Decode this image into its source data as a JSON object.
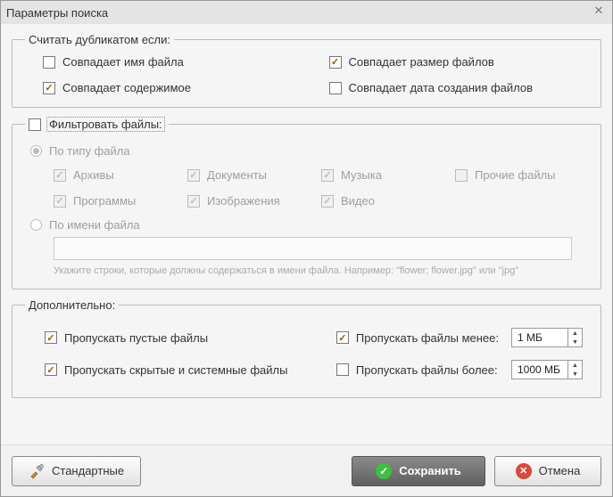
{
  "window": {
    "title": "Параметры поиска"
  },
  "dup": {
    "legend": "Считать дубликатом если:",
    "match_name": "Совпадает имя файла",
    "match_name_checked": false,
    "match_size": "Совпадает размер файлов",
    "match_size_checked": true,
    "match_content": "Совпадает содержимое",
    "match_content_checked": true,
    "match_date": "Совпадает дата создания файлов",
    "match_date_checked": false
  },
  "filter": {
    "legend": "Фильтровать файлы:",
    "enabled": false,
    "by_type": "По типу файла",
    "by_type_selected": true,
    "types": {
      "archives": "Архивы",
      "documents": "Документы",
      "music": "Музыка",
      "other": "Прочие файлы",
      "programs": "Программы",
      "images": "Изображения",
      "video": "Видео"
    },
    "type_checks": {
      "archives": true,
      "documents": true,
      "music": true,
      "other": false,
      "programs": true,
      "images": true,
      "video": true
    },
    "by_name": "По имени файла",
    "by_name_selected": false,
    "hint": "Укажите строки, которые должны содержаться в имени файла. Например: \"flower; flower.jpg\" или \"jpg\""
  },
  "addl": {
    "legend": "Дополнительно:",
    "skip_empty": "Пропускать пустые файлы",
    "skip_empty_checked": true,
    "skip_hidden": "Пропускать скрытые и системные файлы",
    "skip_hidden_checked": true,
    "skip_less": "Пропускать файлы менее:",
    "skip_less_checked": true,
    "skip_less_value": "1 МБ",
    "skip_more": "Пропускать файлы более:",
    "skip_more_checked": false,
    "skip_more_value": "1000 МБ"
  },
  "buttons": {
    "standard": "Стандартные",
    "save": "Сохранить",
    "cancel": "Отмена"
  }
}
